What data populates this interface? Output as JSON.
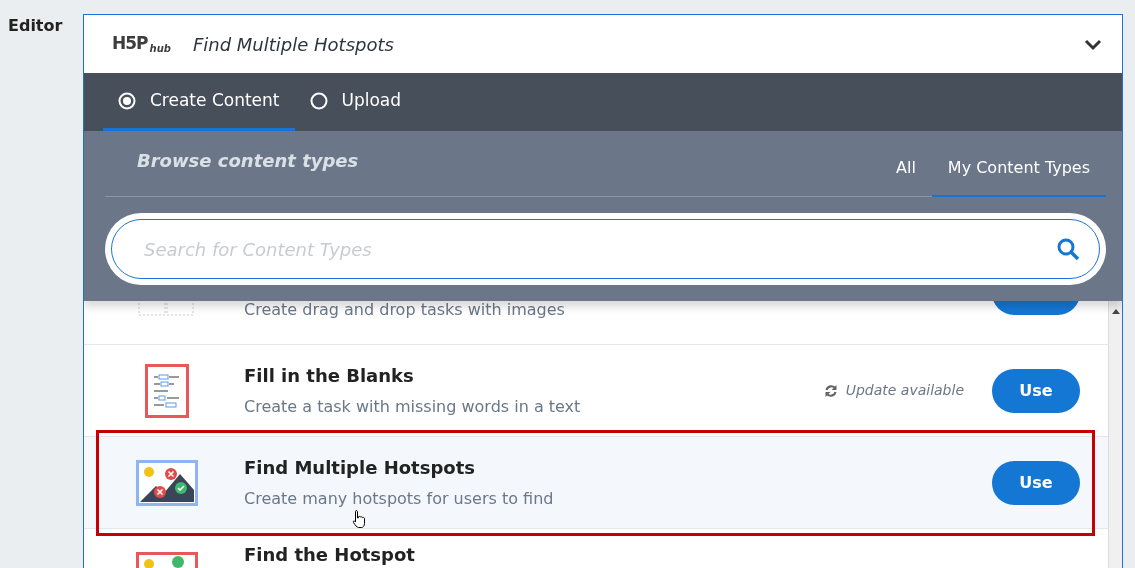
{
  "field_label": "Editor",
  "hub": {
    "logo": "H5P",
    "logo_suffix": "hub",
    "title": "Find Multiple Hotspots",
    "expanded": true
  },
  "modes": [
    {
      "label": "Create Content",
      "selected": true
    },
    {
      "label": "Upload",
      "selected": false
    }
  ],
  "browse": {
    "heading": "Browse content types",
    "tabs": [
      {
        "label": "All",
        "selected": false
      },
      {
        "label": "My Content Types",
        "selected": true
      }
    ],
    "search": {
      "placeholder": "Search for Content Types"
    }
  },
  "content_types": [
    {
      "kind": "dragdrop",
      "description": "Create drag and drop tasks with images",
      "selected": false
    },
    {
      "kind": "blanks",
      "title": "Fill in the Blanks",
      "description": "Create a task with missing words in a text",
      "update": "Update available",
      "button": "Use",
      "selected": false
    },
    {
      "kind": "hotspots",
      "title": "Find Multiple Hotspots",
      "description": "Create many hotspots for users to find",
      "button": "Use",
      "selected": true
    },
    {
      "kind": "hotspot",
      "title": "Find the Hotspot",
      "selected": false
    }
  ]
}
